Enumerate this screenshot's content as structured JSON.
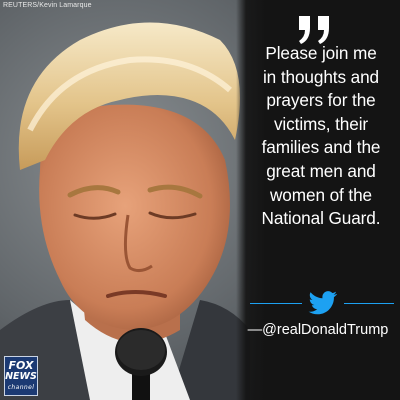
{
  "photo_credit": "REUTERS/Kevin Lamarque",
  "quote_lines": [
    "Please join me",
    "in thoughts and",
    "prayers for the",
    "victims, their",
    "families and the",
    "great men and",
    "women of the",
    "National Guard."
  ],
  "attribution": "—@realDonaldTrump",
  "logo": {
    "line1": "FOX",
    "line2": "NEWS",
    "line3": "channel"
  },
  "colors": {
    "panel_bg": "#141414",
    "accent_blue": "#1da1f2",
    "text": "#ffffff"
  },
  "icons": [
    "quote-mark-icon",
    "twitter-bird-icon",
    "fox-news-logo"
  ]
}
